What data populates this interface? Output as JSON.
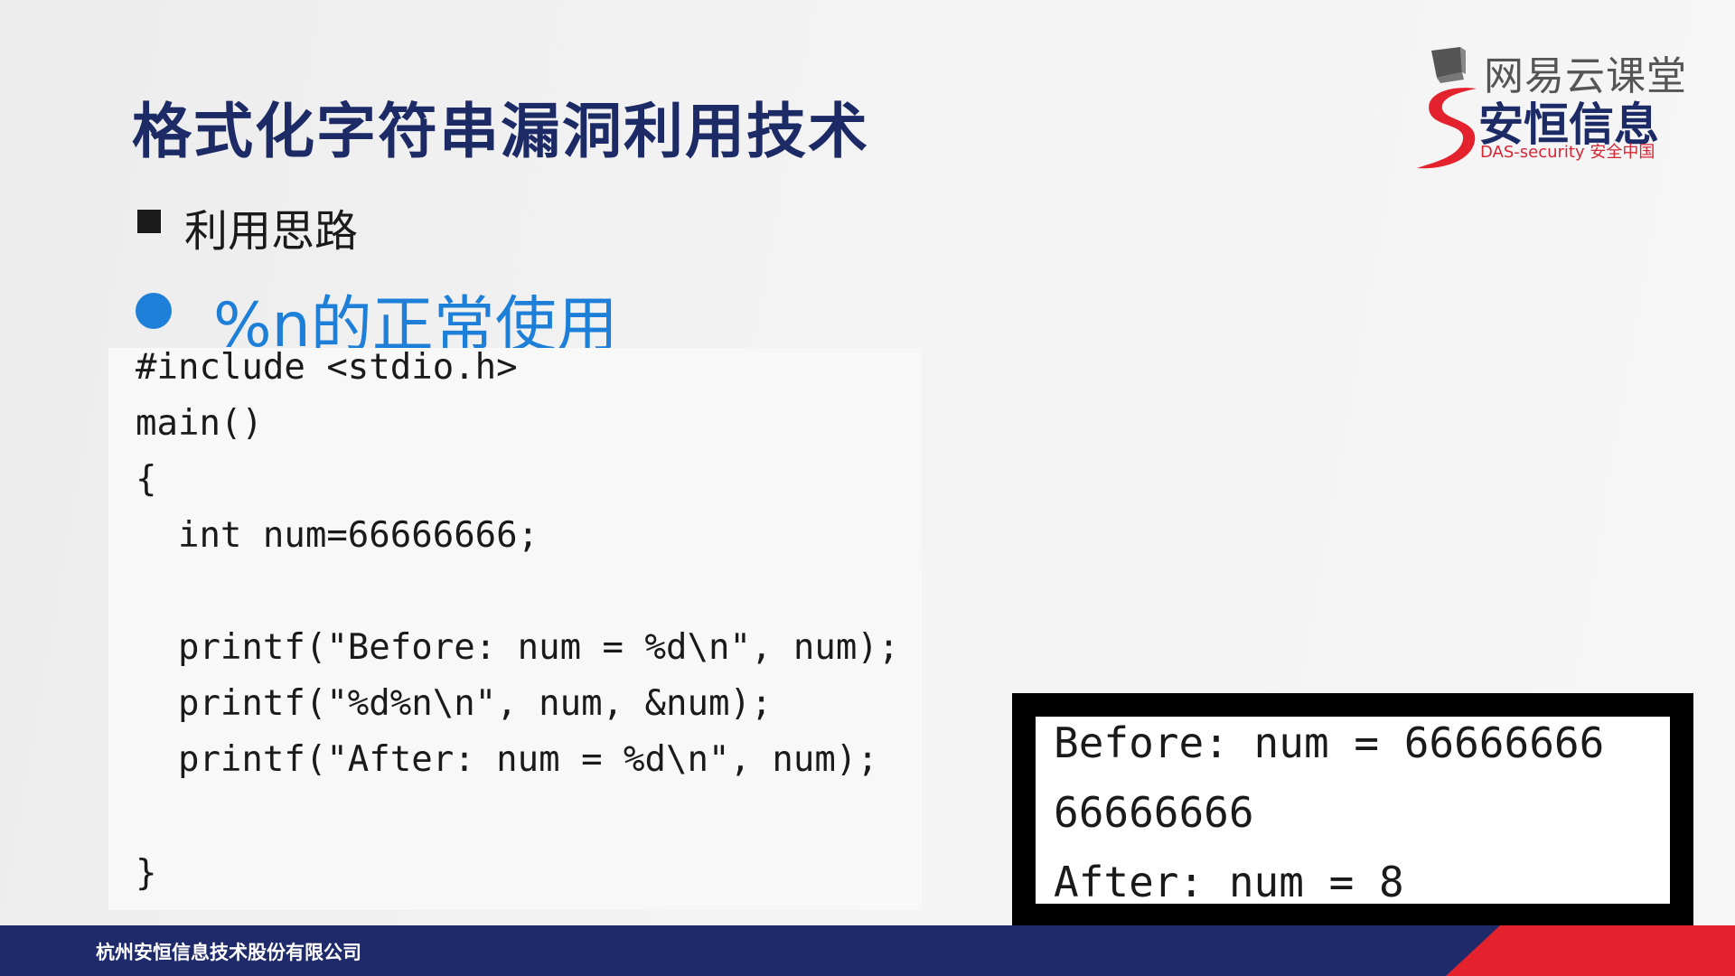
{
  "slide": {
    "title": "格式化字符串漏洞利用技术",
    "bullet_square": "利用思路",
    "bullet_dot": "%n的正常使用"
  },
  "code": {
    "lines": [
      "#include <stdio.h>",
      "main()",
      "{",
      "  int num=66666666;",
      "  printf(\"Before: num = %d\\n\", num);",
      "  printf(\"%d%n\\n\", num, &num);",
      "  printf(\"After: num = %d\\n\", num);",
      "}"
    ]
  },
  "console": {
    "lines": [
      "Before: num = 66666666",
      "66666666",
      "After: num = 8"
    ]
  },
  "logo": {
    "netease": "网易云课堂",
    "brand": "安恒信息",
    "sub": "DAS-security 安全中国"
  },
  "footer": {
    "company": "杭州安恒信息技术股份有限公司"
  },
  "colors": {
    "title": "#1c2a66",
    "accent_blue": "#1e7fd8",
    "footer_navy": "#1f2a6b",
    "footer_red": "#e3222d"
  }
}
